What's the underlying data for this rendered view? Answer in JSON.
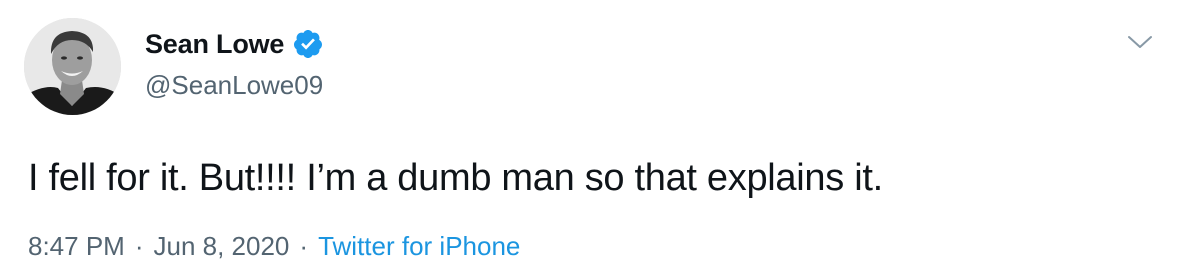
{
  "author": {
    "display_name": "Sean Lowe",
    "handle": "@SeanLowe09",
    "verified": true,
    "verified_icon": "verified-badge-icon",
    "avatar_icon": "profile-avatar"
  },
  "tweet": {
    "text": "I fell for it. But!!!! I’m a dumb man so that explains it."
  },
  "meta": {
    "time": "8:47 PM",
    "separator_1": "·",
    "date": "Jun 8, 2020",
    "separator_2": "·",
    "source": "Twitter for iPhone"
  },
  "menu": {
    "icon": "chevron-down-icon"
  },
  "colors": {
    "text_primary": "#0f1419",
    "text_secondary": "#536471",
    "link": "#1b95e0",
    "verified": "#1d9bf0"
  }
}
